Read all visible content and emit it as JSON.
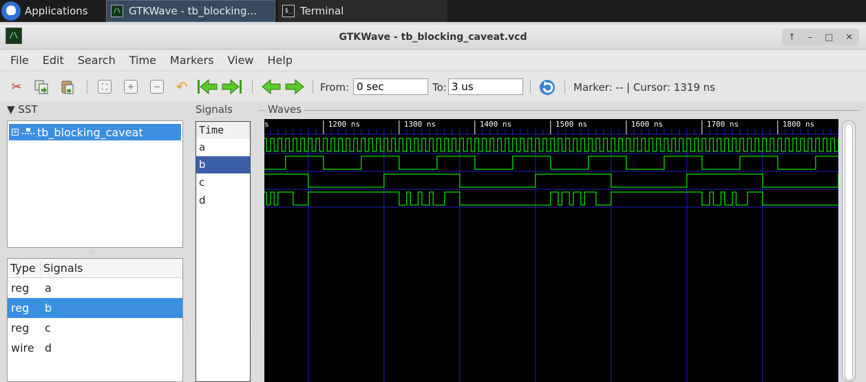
{
  "taskbar": {
    "applications_label": "Applications",
    "window1_label": "GTKWave - tb_blocking...",
    "window2_label": "Terminal"
  },
  "window": {
    "title": "GTKWave - tb_blocking_caveat.vcd",
    "controls": [
      "↑",
      "–",
      "□",
      "✕"
    ]
  },
  "menu": [
    "File",
    "Edit",
    "Search",
    "Time",
    "Markers",
    "View",
    "Help"
  ],
  "toolbar": {
    "from_label": "From:",
    "from_value": "0 sec",
    "to_label": "To:",
    "to_value": "3 us",
    "marker_text": "Marker: --  |  Cursor: 1319 ns"
  },
  "sst": {
    "header": "▼ SST",
    "tree_item": "tb_blocking_caveat",
    "table_headers": [
      "Type",
      "Signals"
    ],
    "rows": [
      {
        "type": "reg",
        "name": "a",
        "selected": false
      },
      {
        "type": "reg",
        "name": "b",
        "selected": true
      },
      {
        "type": "reg",
        "name": "c",
        "selected": false
      },
      {
        "type": "wire",
        "name": "d",
        "selected": false
      }
    ]
  },
  "signals": {
    "title": "Signals",
    "time_label": "Time",
    "names": [
      "a",
      "b",
      "c",
      "d"
    ],
    "selected": "b"
  },
  "waves": {
    "title": "Waves",
    "tick_labels": [
      "s",
      "1200 ns",
      "1300 ns",
      "1400 ns",
      "1500 ns",
      "1600 ns",
      "1700 ns",
      "1800 ns"
    ],
    "view_start_ns": 1122,
    "ns_per_100_division": 100,
    "colors": {
      "wave": "#00e000",
      "grid": "#2020c0",
      "ruler": "#ffffff"
    }
  }
}
